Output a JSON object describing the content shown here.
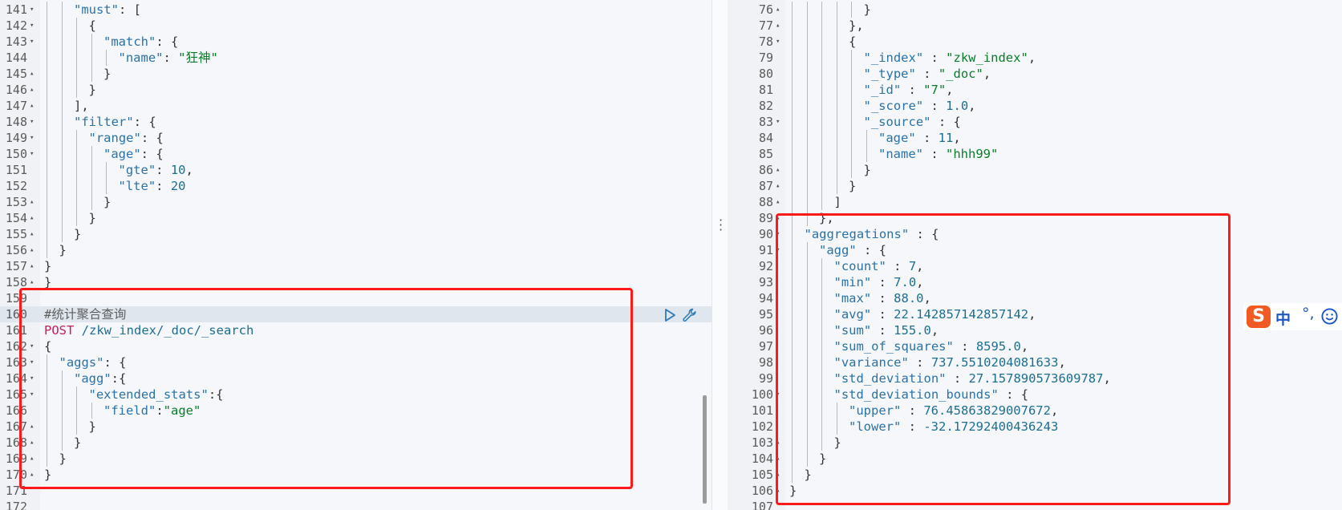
{
  "left_editor": {
    "lines": [
      {
        "n": "141",
        "fold": "v",
        "tokens": [
          [
            "k",
            "\"must\""
          ],
          [
            "p",
            ": ["
          ]
        ]
      },
      {
        "n": "142",
        "fold": "v",
        "tokens": [
          [
            "p",
            "{"
          ]
        ]
      },
      {
        "n": "143",
        "fold": "v",
        "tokens": [
          [
            "k",
            "\"match\""
          ],
          [
            "p",
            ": {"
          ]
        ]
      },
      {
        "n": "144",
        "fold": "",
        "tokens": [
          [
            "k",
            "\"name\""
          ],
          [
            "p",
            ": "
          ],
          [
            "s",
            "\"狂神\""
          ]
        ]
      },
      {
        "n": "145",
        "fold": "^",
        "tokens": [
          [
            "p",
            "}"
          ]
        ]
      },
      {
        "n": "146",
        "fold": "^",
        "tokens": [
          [
            "p",
            "}"
          ]
        ]
      },
      {
        "n": "147",
        "fold": "^",
        "tokens": [
          [
            "p",
            "],"
          ]
        ]
      },
      {
        "n": "148",
        "fold": "v",
        "tokens": [
          [
            "k",
            "\"filter\""
          ],
          [
            "p",
            ": {"
          ]
        ]
      },
      {
        "n": "149",
        "fold": "v",
        "tokens": [
          [
            "k",
            "\"range\""
          ],
          [
            "p",
            ": {"
          ]
        ]
      },
      {
        "n": "150",
        "fold": "v",
        "tokens": [
          [
            "k",
            "\"age\""
          ],
          [
            "p",
            ": {"
          ]
        ]
      },
      {
        "n": "151",
        "fold": "",
        "tokens": [
          [
            "k",
            "\"gte\""
          ],
          [
            "p",
            ": "
          ],
          [
            "n",
            "10"
          ],
          [
            "p",
            ","
          ]
        ]
      },
      {
        "n": "152",
        "fold": "",
        "tokens": [
          [
            "k",
            "\"lte\""
          ],
          [
            "p",
            ": "
          ],
          [
            "n",
            "20"
          ]
        ]
      },
      {
        "n": "153",
        "fold": "^",
        "tokens": [
          [
            "p",
            "}"
          ]
        ]
      },
      {
        "n": "154",
        "fold": "^",
        "tokens": [
          [
            "p",
            "}"
          ]
        ]
      },
      {
        "n": "155",
        "fold": "^",
        "tokens": [
          [
            "p",
            "}"
          ]
        ]
      },
      {
        "n": "156",
        "fold": "^",
        "tokens": [
          [
            "p",
            "}"
          ]
        ]
      },
      {
        "n": "157",
        "fold": "^",
        "tokens": [
          [
            "p",
            "}"
          ]
        ]
      },
      {
        "n": "158",
        "fold": "^",
        "tokens": [
          [
            "p",
            "}"
          ]
        ]
      },
      {
        "n": "159",
        "fold": "",
        "tokens": []
      },
      {
        "n": "160",
        "fold": "",
        "tokens": [
          [
            "c",
            "#统计聚合查询"
          ]
        ]
      },
      {
        "n": "161",
        "fold": "",
        "tokens": [
          [
            "m",
            "POST"
          ],
          [
            "p",
            " "
          ],
          [
            "u",
            "/zkw_index/_doc/_search"
          ]
        ]
      },
      {
        "n": "162",
        "fold": "v",
        "tokens": [
          [
            "p",
            "{"
          ]
        ]
      },
      {
        "n": "163",
        "fold": "v",
        "tokens": [
          [
            "k",
            "\"aggs\""
          ],
          [
            "p",
            ": {"
          ]
        ]
      },
      {
        "n": "164",
        "fold": "v",
        "tokens": [
          [
            "k",
            "\"agg\""
          ],
          [
            "p",
            ":{"
          ]
        ]
      },
      {
        "n": "165",
        "fold": "v",
        "tokens": [
          [
            "k",
            "\"extended_stats\""
          ],
          [
            "p",
            ":{"
          ]
        ]
      },
      {
        "n": "166",
        "fold": "",
        "tokens": [
          [
            "k",
            "\"field\""
          ],
          [
            "p",
            ":"
          ],
          [
            "s",
            "\"age\""
          ]
        ]
      },
      {
        "n": "167",
        "fold": "^",
        "tokens": [
          [
            "p",
            "}"
          ]
        ]
      },
      {
        "n": "168",
        "fold": "^",
        "tokens": [
          [
            "p",
            "}"
          ]
        ]
      },
      {
        "n": "169",
        "fold": "^",
        "tokens": [
          [
            "p",
            "}"
          ]
        ]
      },
      {
        "n": "170",
        "fold": "^",
        "tokens": [
          [
            "p",
            "}"
          ]
        ]
      },
      {
        "n": "171",
        "fold": "",
        "tokens": []
      },
      {
        "n": "172",
        "fold": "",
        "tokens": []
      }
    ]
  },
  "right_editor": {
    "lines": [
      {
        "n": "76",
        "fold": "^",
        "tokens": [
          [
            "p",
            "}"
          ]
        ]
      },
      {
        "n": "77",
        "fold": "^",
        "tokens": [
          [
            "p",
            "},"
          ]
        ]
      },
      {
        "n": "78",
        "fold": "v",
        "tokens": [
          [
            "p",
            "{"
          ]
        ]
      },
      {
        "n": "79",
        "fold": "",
        "tokens": [
          [
            "k",
            "\"_index\""
          ],
          [
            "p",
            " : "
          ],
          [
            "s",
            "\"zkw_index\""
          ],
          [
            "p",
            ","
          ]
        ]
      },
      {
        "n": "80",
        "fold": "",
        "tokens": [
          [
            "k",
            "\"_type\""
          ],
          [
            "p",
            " : "
          ],
          [
            "s",
            "\"_doc\""
          ],
          [
            "p",
            ","
          ]
        ]
      },
      {
        "n": "81",
        "fold": "",
        "tokens": [
          [
            "k",
            "\"_id\""
          ],
          [
            "p",
            " : "
          ],
          [
            "s",
            "\"7\""
          ],
          [
            "p",
            ","
          ]
        ]
      },
      {
        "n": "82",
        "fold": "",
        "tokens": [
          [
            "k",
            "\"_score\""
          ],
          [
            "p",
            " : "
          ],
          [
            "n",
            "1.0"
          ],
          [
            "p",
            ","
          ]
        ]
      },
      {
        "n": "83",
        "fold": "v",
        "tokens": [
          [
            "k",
            "\"_source\""
          ],
          [
            "p",
            " : {"
          ]
        ]
      },
      {
        "n": "84",
        "fold": "",
        "tokens": [
          [
            "k",
            "\"age\""
          ],
          [
            "p",
            " : "
          ],
          [
            "n",
            "11"
          ],
          [
            "p",
            ","
          ]
        ]
      },
      {
        "n": "85",
        "fold": "",
        "tokens": [
          [
            "k",
            "\"name\""
          ],
          [
            "p",
            " : "
          ],
          [
            "s",
            "\"hhh99\""
          ]
        ]
      },
      {
        "n": "86",
        "fold": "^",
        "tokens": [
          [
            "p",
            "}"
          ]
        ]
      },
      {
        "n": "87",
        "fold": "^",
        "tokens": [
          [
            "p",
            "}"
          ]
        ]
      },
      {
        "n": "88",
        "fold": "^",
        "tokens": [
          [
            "p",
            "]"
          ]
        ]
      },
      {
        "n": "89",
        "fold": "^",
        "tokens": [
          [
            "p",
            "},"
          ]
        ]
      },
      {
        "n": "90",
        "fold": "v",
        "tokens": [
          [
            "k",
            "\"aggregations\""
          ],
          [
            "p",
            " : {"
          ]
        ]
      },
      {
        "n": "91",
        "fold": "v",
        "tokens": [
          [
            "k",
            "\"agg\""
          ],
          [
            "p",
            " : {"
          ]
        ]
      },
      {
        "n": "92",
        "fold": "",
        "tokens": [
          [
            "k",
            "\"count\""
          ],
          [
            "p",
            " : "
          ],
          [
            "n",
            "7"
          ],
          [
            "p",
            ","
          ]
        ]
      },
      {
        "n": "93",
        "fold": "",
        "tokens": [
          [
            "k",
            "\"min\""
          ],
          [
            "p",
            " : "
          ],
          [
            "n",
            "7.0"
          ],
          [
            "p",
            ","
          ]
        ]
      },
      {
        "n": "94",
        "fold": "",
        "tokens": [
          [
            "k",
            "\"max\""
          ],
          [
            "p",
            " : "
          ],
          [
            "n",
            "88.0"
          ],
          [
            "p",
            ","
          ]
        ]
      },
      {
        "n": "95",
        "fold": "",
        "tokens": [
          [
            "k",
            "\"avg\""
          ],
          [
            "p",
            " : "
          ],
          [
            "n",
            "22.142857142857142"
          ],
          [
            "p",
            ","
          ]
        ]
      },
      {
        "n": "96",
        "fold": "",
        "tokens": [
          [
            "k",
            "\"sum\""
          ],
          [
            "p",
            " : "
          ],
          [
            "n",
            "155.0"
          ],
          [
            "p",
            ","
          ]
        ]
      },
      {
        "n": "97",
        "fold": "",
        "tokens": [
          [
            "k",
            "\"sum_of_squares\""
          ],
          [
            "p",
            " : "
          ],
          [
            "n",
            "8595.0"
          ],
          [
            "p",
            ","
          ]
        ]
      },
      {
        "n": "98",
        "fold": "",
        "tokens": [
          [
            "k",
            "\"variance\""
          ],
          [
            "p",
            " : "
          ],
          [
            "n",
            "737.5510204081633"
          ],
          [
            "p",
            ","
          ]
        ]
      },
      {
        "n": "99",
        "fold": "",
        "tokens": [
          [
            "k",
            "\"std_deviation\""
          ],
          [
            "p",
            " : "
          ],
          [
            "n",
            "27.157890573609787"
          ],
          [
            "p",
            ","
          ]
        ]
      },
      {
        "n": "100",
        "fold": "v",
        "tokens": [
          [
            "k",
            "\"std_deviation_bounds\""
          ],
          [
            "p",
            " : {"
          ]
        ]
      },
      {
        "n": "101",
        "fold": "",
        "tokens": [
          [
            "k",
            "\"upper\""
          ],
          [
            "p",
            " : "
          ],
          [
            "n",
            "76.45863829007672"
          ],
          [
            "p",
            ","
          ]
        ]
      },
      {
        "n": "102",
        "fold": "",
        "tokens": [
          [
            "k",
            "\"lower\""
          ],
          [
            "p",
            " : "
          ],
          [
            "n",
            "-32.17292400436243"
          ]
        ]
      },
      {
        "n": "103",
        "fold": "^",
        "tokens": [
          [
            "p",
            "}"
          ]
        ]
      },
      {
        "n": "104",
        "fold": "^",
        "tokens": [
          [
            "p",
            "}"
          ]
        ]
      },
      {
        "n": "105",
        "fold": "^",
        "tokens": [
          [
            "p",
            "}"
          ]
        ]
      },
      {
        "n": "106",
        "fold": "^",
        "tokens": [
          [
            "p",
            "}"
          ]
        ]
      },
      {
        "n": "107",
        "fold": "",
        "tokens": []
      }
    ]
  },
  "toolbar": {
    "run_icon": "play-icon",
    "settings_icon": "wrench-icon"
  },
  "ime": {
    "logo_text": "S",
    "lang_text": "中",
    "punct_text": "°,",
    "emoji_icon": "smiley-icon"
  },
  "colors": {
    "highlight_box": "#ff1a1a",
    "json_key": "#2a72a8",
    "json_string": "#0a7d2a",
    "json_number": "#1c6e92",
    "http_method": "#c81d5e"
  }
}
